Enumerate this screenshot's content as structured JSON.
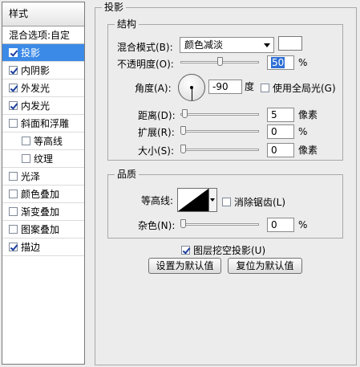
{
  "left_panel": {
    "header": "样式",
    "blend_options": "混合选项:自定",
    "items": [
      {
        "label": "投影",
        "checked": true,
        "selected": true,
        "indent": false
      },
      {
        "label": "内阴影",
        "checked": true,
        "selected": false,
        "indent": false
      },
      {
        "label": "外发光",
        "checked": true,
        "selected": false,
        "indent": false
      },
      {
        "label": "内发光",
        "checked": true,
        "selected": false,
        "indent": false
      },
      {
        "label": "斜面和浮雕",
        "checked": false,
        "selected": false,
        "indent": false
      },
      {
        "label": "等高线",
        "checked": false,
        "selected": false,
        "indent": true
      },
      {
        "label": "纹理",
        "checked": false,
        "selected": false,
        "indent": true
      },
      {
        "label": "光泽",
        "checked": false,
        "selected": false,
        "indent": false
      },
      {
        "label": "颜色叠加",
        "checked": false,
        "selected": false,
        "indent": false
      },
      {
        "label": "渐变叠加",
        "checked": false,
        "selected": false,
        "indent": false
      },
      {
        "label": "图案叠加",
        "checked": false,
        "selected": false,
        "indent": false
      },
      {
        "label": "描边",
        "checked": true,
        "selected": false,
        "indent": false
      }
    ]
  },
  "drop_shadow": {
    "title": "投影",
    "structure": {
      "title": "结构",
      "blend_mode_label": "混合模式(B):",
      "blend_mode_value": "颜色减淡",
      "swatch_color": "#ffffff",
      "opacity_label": "不透明度(O):",
      "opacity_value": "50",
      "opacity_fraction": 0.5,
      "percent_unit": "%",
      "angle_label": "角度(A):",
      "angle_value": "-90",
      "angle_unit": "度",
      "global_light_label": "使用全局光(G)",
      "global_light_checked": false,
      "distance_label": "距离(D):",
      "distance_value": "5",
      "distance_fraction": 0.02,
      "pixel_unit": "像素",
      "spread_label": "扩展(R):",
      "spread_value": "0",
      "spread_fraction": 0.0,
      "size_label": "大小(S):",
      "size_value": "0",
      "size_fraction": 0.0
    },
    "quality": {
      "title": "品质",
      "contour_label": "等高线:",
      "antialias_label": "消除锯齿(L)",
      "antialias_checked": false,
      "noise_label": "杂色(N):",
      "noise_value": "0",
      "noise_fraction": 0.0
    },
    "knockout_label": "图层挖空投影(U)",
    "knockout_checked": true,
    "set_default_label": "设置为默认值",
    "reset_default_label": "复位为默认值"
  },
  "colors": {
    "selection": "#3c8ae8",
    "check": "#1d3f9f",
    "highlight": "#2f6fd6"
  }
}
